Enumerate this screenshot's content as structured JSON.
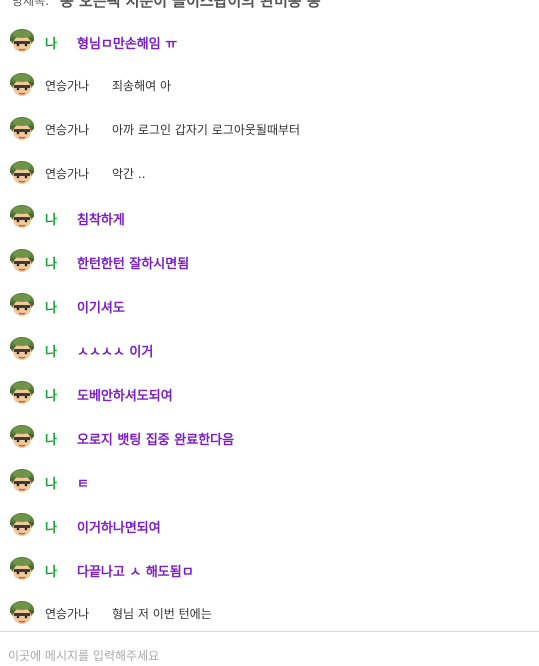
{
  "header": {
    "prefix": "방제목:",
    "title": "봉 오픈팩 서준이 올이스팝이의 완미봉 봉"
  },
  "colors": {
    "me_name": "#19a23a",
    "me_message": "#7b1fc4",
    "other_text": "#333333"
  },
  "messages": [
    {
      "sender": "나",
      "text": "형님ㅁ만손해임 ㅠ",
      "me": true
    },
    {
      "sender": "연승가나",
      "text": "죄송해여 아",
      "me": false
    },
    {
      "sender": "연승가나",
      "text": "아까 로그인 갑자기 로그아웃될때부터",
      "me": false
    },
    {
      "sender": "연승가나",
      "text": "악간 ..",
      "me": false
    },
    {
      "sender": "나",
      "text": "침착하게",
      "me": true
    },
    {
      "sender": "나",
      "text": "한턴한턴 잘하시면됨",
      "me": true
    },
    {
      "sender": "나",
      "text": "이기셔도",
      "me": true
    },
    {
      "sender": "나",
      "text": "ㅅㅅㅅㅅ 이거",
      "me": true
    },
    {
      "sender": "나",
      "text": "도베안하셔도되여",
      "me": true
    },
    {
      "sender": "나",
      "text": "오로지 뱃팅 집중 완료한다음",
      "me": true
    },
    {
      "sender": "나",
      "text": "ㅌ",
      "me": true
    },
    {
      "sender": "나",
      "text": "이거하나면되여",
      "me": true
    },
    {
      "sender": "나",
      "text": "다끝나고 ㅅ 해도됨ㅁ",
      "me": true
    },
    {
      "sender": "연승가나",
      "text": "형님 저 이번 턴에는",
      "me": false
    }
  ],
  "input": {
    "placeholder": "이곳에 메시지를 입력해주세요"
  },
  "icons": {
    "avatar": "soldier-avatar-icon"
  }
}
